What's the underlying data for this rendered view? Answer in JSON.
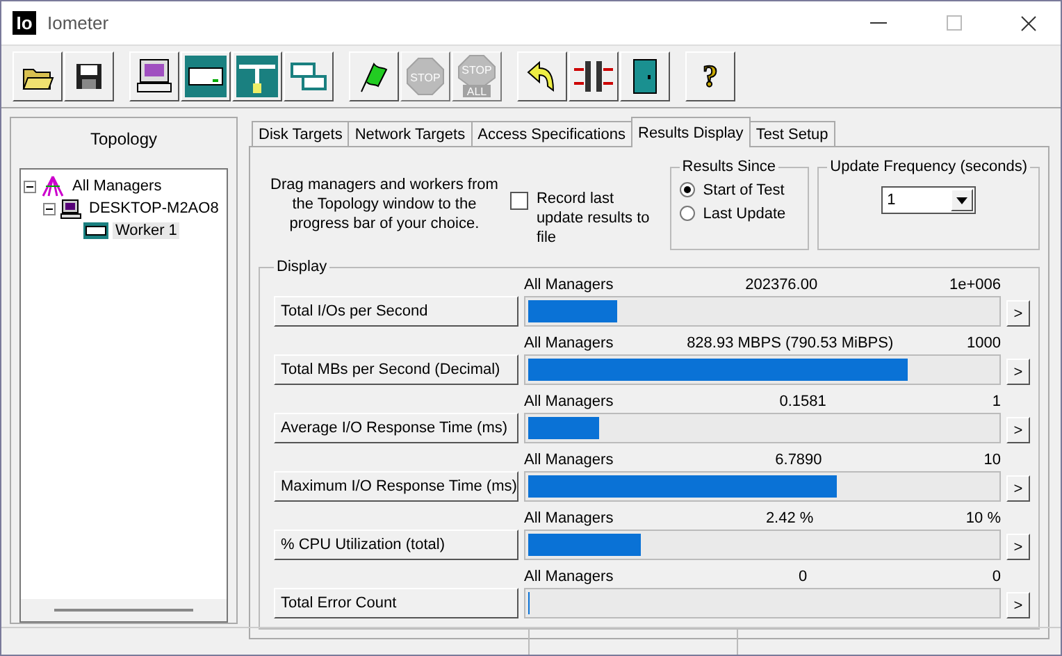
{
  "window": {
    "logo": "Io",
    "title": "Iometer"
  },
  "toolbar": [
    {
      "kind": "open",
      "disabled": false
    },
    {
      "kind": "save",
      "disabled": false
    },
    {
      "kind": "gap"
    },
    {
      "kind": "computer",
      "disabled": false
    },
    {
      "kind": "disk",
      "disabled": false
    },
    {
      "kind": "network",
      "disabled": false
    },
    {
      "kind": "workers",
      "disabled": false
    },
    {
      "kind": "gap"
    },
    {
      "kind": "flag",
      "disabled": false
    },
    {
      "kind": "stop",
      "label": "STOP",
      "disabled": true
    },
    {
      "kind": "stop_all",
      "label": "STOP",
      "sublabel": "ALL",
      "disabled": true
    },
    {
      "kind": "gap"
    },
    {
      "kind": "reset",
      "disabled": false
    },
    {
      "kind": "compare",
      "disabled": false
    },
    {
      "kind": "exit",
      "disabled": false
    },
    {
      "kind": "gap"
    },
    {
      "kind": "help",
      "label": "?",
      "disabled": false
    }
  ],
  "topology": {
    "title": "Topology",
    "tree": [
      {
        "label": "All Managers",
        "kind": "managers",
        "expanded": true,
        "selected": false,
        "children": [
          {
            "label": "DESKTOP-M2AO8",
            "kind": "computer",
            "expanded": true,
            "selected": false,
            "children": [
              {
                "label": "Worker 1",
                "kind": "worker",
                "selected": true
              }
            ]
          }
        ]
      }
    ]
  },
  "tabs": [
    {
      "label": "Disk Targets",
      "selected": false
    },
    {
      "label": "Network Targets",
      "selected": false
    },
    {
      "label": "Access Specifications",
      "selected": false
    },
    {
      "label": "Results Display",
      "selected": true
    },
    {
      "label": "Test Setup",
      "selected": false
    }
  ],
  "instructions": "Drag managers and workers from the Topology window to the progress bar of your choice.",
  "record": {
    "label": "Record last update results to file",
    "checked": false
  },
  "results_since": {
    "title": "Results Since",
    "options": [
      {
        "label": "Start of Test",
        "selected": true
      },
      {
        "label": "Last Update",
        "selected": false
      }
    ]
  },
  "update_frequency": {
    "title": "Update Frequency (seconds)",
    "value": "1"
  },
  "display": {
    "title": "Display",
    "rows": [
      {
        "metric": "Total I/Os per Second",
        "source": "All Managers",
        "reading": "202376.00",
        "max": "1e+006",
        "level": 0.19
      },
      {
        "metric": "Total MBs per Second (Decimal)",
        "source": "All Managers",
        "reading": "828.93 MBPS (790.53 MiBPS)",
        "max": "1000",
        "level": 0.81
      },
      {
        "metric": "Average I/O Response Time (ms)",
        "source": "All Managers",
        "reading": "0.1581",
        "max": "1",
        "level": 0.15
      },
      {
        "metric": "Maximum I/O Response Time (ms)",
        "source": "All Managers",
        "reading": "6.7890",
        "max": "10",
        "level": 0.66
      },
      {
        "metric": "% CPU Utilization (total)",
        "source": "All Managers",
        "reading": "2.42 %",
        "max": "10 %",
        "level": 0.24
      },
      {
        "metric": "Total Error Count",
        "source": "All Managers",
        "reading": "0",
        "max": "0",
        "level": 0
      }
    ],
    "more": ">"
  }
}
